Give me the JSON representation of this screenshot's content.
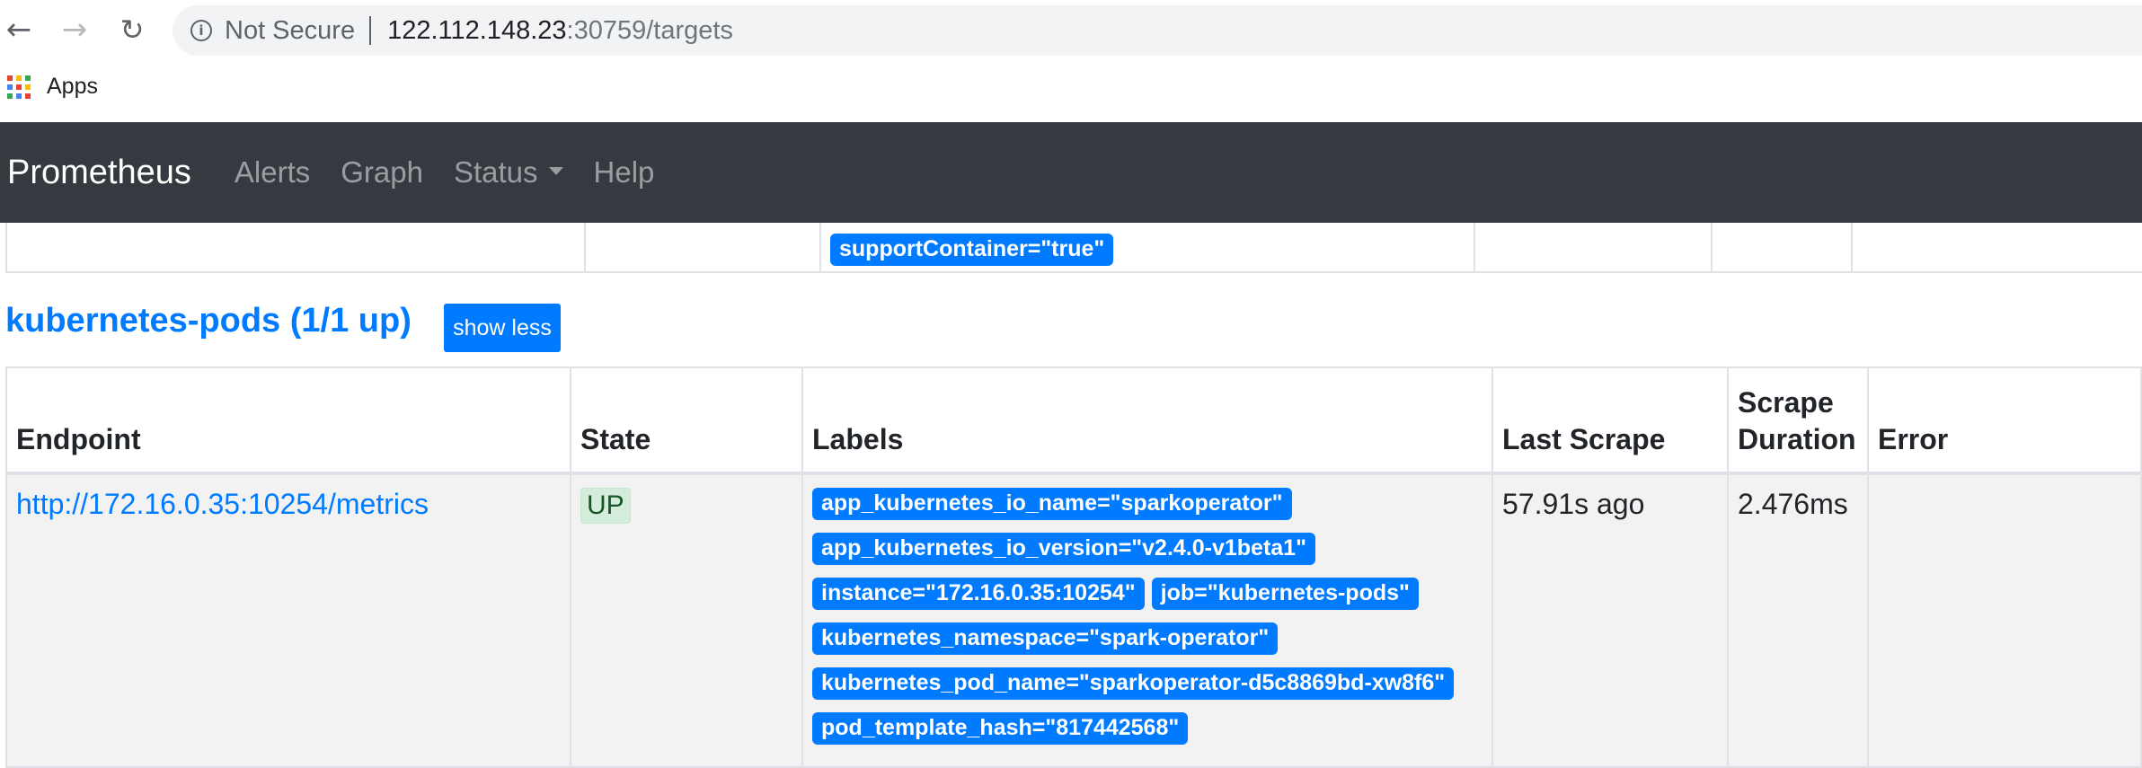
{
  "browser": {
    "not_secure_label": "Not Secure",
    "url_host": "122.112.148.23",
    "url_rest": ":30759/targets",
    "bookmarks": {
      "apps_label": "Apps"
    }
  },
  "navbar": {
    "brand": "Prometheus",
    "links": [
      "Alerts",
      "Graph",
      "Status",
      "Help"
    ]
  },
  "previous_section": {
    "last_label": "supportContainer=\"true\""
  },
  "section": {
    "title": "kubernetes-pods (1/1 up)",
    "toggle_label": "show less"
  },
  "table": {
    "headers": {
      "endpoint": "Endpoint",
      "state": "State",
      "labels": "Labels",
      "last_scrape": "Last Scrape",
      "scrape_duration_1": "Scrape",
      "scrape_duration_2": "Duration",
      "error": "Error"
    },
    "rows": [
      {
        "endpoint": "http://172.16.0.35:10254/metrics",
        "state": "UP",
        "labels": [
          "app_kubernetes_io_name=\"sparkoperator\"",
          "app_kubernetes_io_version=\"v2.4.0-v1beta1\"",
          "instance=\"172.16.0.35:10254\"",
          "job=\"kubernetes-pods\"",
          "kubernetes_namespace=\"spark-operator\"",
          "kubernetes_pod_name=\"sparkoperator-d5c8869bd-xw8f6\"",
          "pod_template_hash=\"817442568\""
        ],
        "last_scrape": "57.91s ago",
        "scrape_duration": "2.476ms",
        "error": ""
      }
    ]
  },
  "colors": {
    "navbar_bg": "#343a40",
    "primary": "#007bff",
    "state_up_bg": "#d4edda",
    "state_up_text": "#155724"
  }
}
